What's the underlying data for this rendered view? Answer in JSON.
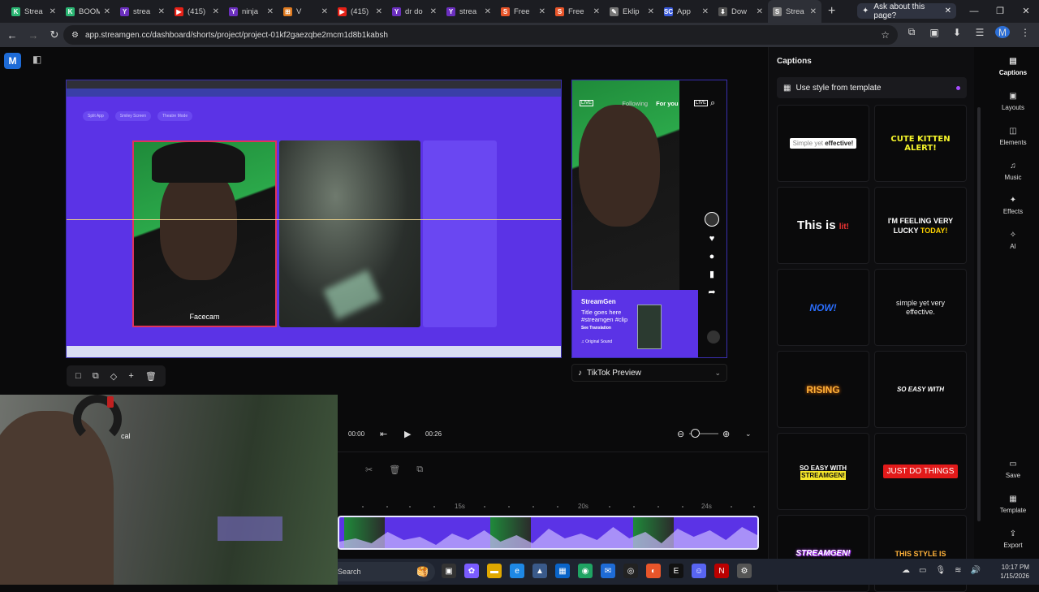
{
  "browser": {
    "tabs": [
      {
        "label": "Strea",
        "color": "#2bb673",
        "glyph": "K"
      },
      {
        "label": "BOOM",
        "color": "#2bb673",
        "glyph": "K"
      },
      {
        "label": "strea",
        "color": "#6b2fbf",
        "glyph": "Y"
      },
      {
        "label": "(415)",
        "color": "#e62117",
        "glyph": "▶"
      },
      {
        "label": "ninja",
        "color": "#6b2fbf",
        "glyph": "Y"
      },
      {
        "label": "V",
        "color": "#e07b20",
        "glyph": "⊞"
      },
      {
        "label": "(415)",
        "color": "#e62117",
        "glyph": "▶"
      },
      {
        "label": "dr do",
        "color": "#6b2fbf",
        "glyph": "Y"
      },
      {
        "label": "strea",
        "color": "#6b2fbf",
        "glyph": "Y"
      },
      {
        "label": "Free",
        "color": "#e8552a",
        "glyph": "S"
      },
      {
        "label": "Free",
        "color": "#e8552a",
        "glyph": "S"
      },
      {
        "label": "Eklip",
        "color": "#777",
        "glyph": "✎"
      },
      {
        "label": "App",
        "color": "#3b5bdb",
        "glyph": "SC"
      },
      {
        "label": "Dow",
        "color": "#555",
        "glyph": "⬇"
      },
      {
        "label": "Strea",
        "color": "#888",
        "glyph": "S"
      }
    ],
    "ask_label": "Ask about this page?",
    "url": "app.streamgen.cc/dashboard/shorts/project/project-01kf2gaezqbe2mcm1d8b1kabsh",
    "profile_initial": "M"
  },
  "app": {
    "logo": "M",
    "facecam_label": "Facecam",
    "inner_buttons": [
      "Split App",
      "Smiley Screen",
      "Theatre Mode"
    ],
    "tiktok": {
      "following": "Following",
      "for_you": "For you",
      "live": "LIVE",
      "username": "StreamGen",
      "caption_line1": "Title goes here",
      "caption_line2": "#streamgen #clip",
      "translation": "See Translation",
      "sound": "♫ Original Sound"
    },
    "tiktok_preview_label": "TikTok Preview",
    "webcam_text": "cal",
    "timeline": {
      "start_time": "00:00",
      "end_time": "00:26",
      "ruler_labels": [
        "15s",
        "20s",
        "24s"
      ]
    }
  },
  "captions_panel": {
    "title": "Captions",
    "use_style_label": "Use style from template",
    "styles": [
      {
        "id": "simple-effective",
        "text": "Simple yet ",
        "highlight": "effective!"
      },
      {
        "id": "cute-kitten",
        "text": "CUTE KITTEN ALERT!"
      },
      {
        "id": "this-is-lit",
        "text": "This is ",
        "highlight": "lit!"
      },
      {
        "id": "feeling-lucky",
        "text": "I'M FEELING VERY LUCKY ",
        "highlight": "TODAY!"
      },
      {
        "id": "now",
        "text": "NOW!"
      },
      {
        "id": "simple-very-effective",
        "text": "simple yet very effective."
      },
      {
        "id": "rising",
        "text": "RISING"
      },
      {
        "id": "so-easy-with",
        "text": "SO EASY WITH"
      },
      {
        "id": "so-easy-streamgen",
        "text": "SO EASY WITH ",
        "highlight": "STREAMGEN!"
      },
      {
        "id": "just-do-things",
        "text": "JUST DO THINGS"
      },
      {
        "id": "streamgen",
        "text": "STREAMGEN!"
      },
      {
        "id": "this-style-is",
        "text": "THIS STYLE IS"
      }
    ]
  },
  "right_nav": [
    {
      "label": "Captions",
      "icon": "captions-icon",
      "glyph": "▤"
    },
    {
      "label": "Layouts",
      "icon": "layouts-icon",
      "glyph": "▣"
    },
    {
      "label": "Elements",
      "icon": "elements-icon",
      "glyph": "◫"
    },
    {
      "label": "Music",
      "icon": "music-icon",
      "glyph": "♫"
    },
    {
      "label": "Effects",
      "icon": "effects-icon",
      "glyph": "✦"
    },
    {
      "label": "AI",
      "icon": "ai-icon",
      "glyph": "✧"
    },
    {
      "label": "Save",
      "icon": "save-icon",
      "glyph": "▭"
    },
    {
      "label": "Template",
      "icon": "template-icon",
      "glyph": "▦"
    },
    {
      "label": "Export",
      "icon": "export-icon",
      "glyph": "⇪"
    }
  ],
  "os": {
    "search_placeholder": "Search",
    "time": "10:17 PM",
    "date": "1/15/2026"
  }
}
